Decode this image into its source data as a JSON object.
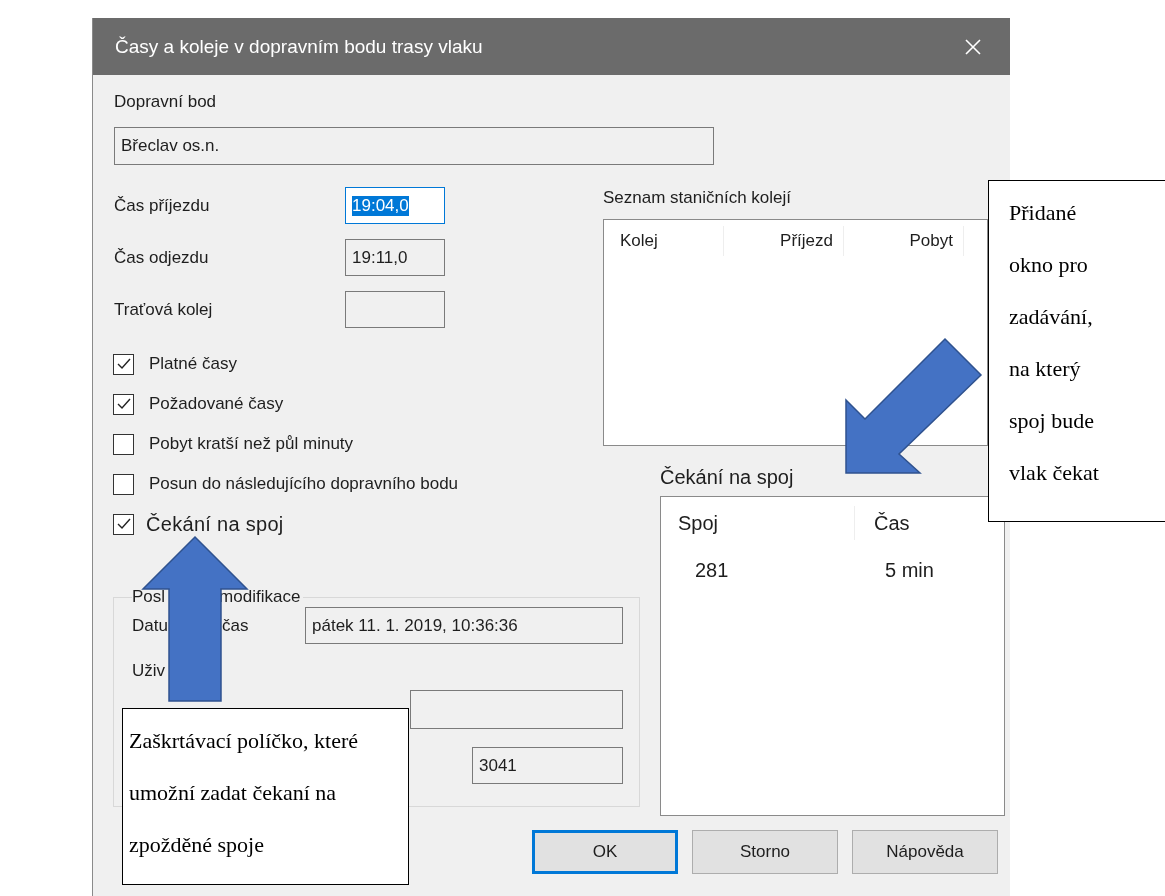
{
  "window": {
    "title": "Časy a koleje v dopravním bodu trasy vlaku"
  },
  "stop_point": {
    "label": "Dopravní bod",
    "value": "Břeclav os.n."
  },
  "time_fields": [
    {
      "label": "Čas příjezdu",
      "value": "19:04,0",
      "focused": true
    },
    {
      "label": "Čas odjezdu",
      "value": "19:11,0",
      "focused": false
    },
    {
      "label": "Traťová kolej",
      "focused": false
    }
  ],
  "checkboxes": [
    {
      "label": "Platné časy",
      "checked": true,
      "large": false
    },
    {
      "label": "Požadované časy",
      "checked": true,
      "large": false
    },
    {
      "label": "Pobyt kratší než půl minuty",
      "checked": false,
      "large": false
    },
    {
      "label": "Posun do následujícího dopravního bodu",
      "checked": false,
      "large": false
    },
    {
      "label": "Čekání na spoj",
      "checked": true,
      "large": true
    }
  ],
  "track_list": {
    "title": "Seznam staničních kolejí",
    "columns": [
      "Kolej",
      "Příjezd",
      "Pobyt"
    ]
  },
  "wait_list": {
    "title": "Čekání na spoj",
    "columns": [
      "Spoj",
      "Čas"
    ],
    "rows": [
      [
        "281",
        "5 min"
      ]
    ]
  },
  "modification": {
    "title_parts": [
      "Posl",
      "modifikace"
    ],
    "date_label_parts": [
      "Datu",
      "čas"
    ],
    "date_value": "pátek 11. 1. 2019, 10:36:36",
    "user_label": "Uživ",
    "number_value": "3041"
  },
  "buttons": [
    {
      "label": "OK",
      "default": true
    },
    {
      "label": "Storno",
      "default": false
    },
    {
      "label": "Nápověda",
      "default": false
    }
  ],
  "callouts": [
    {
      "text": "Přidané okno pro zadávání, na který spoj bude vlak čekat"
    },
    {
      "text": "Zaškrtávací políčko, které umožní zadat čekaní na zpožděné spoje"
    }
  ]
}
